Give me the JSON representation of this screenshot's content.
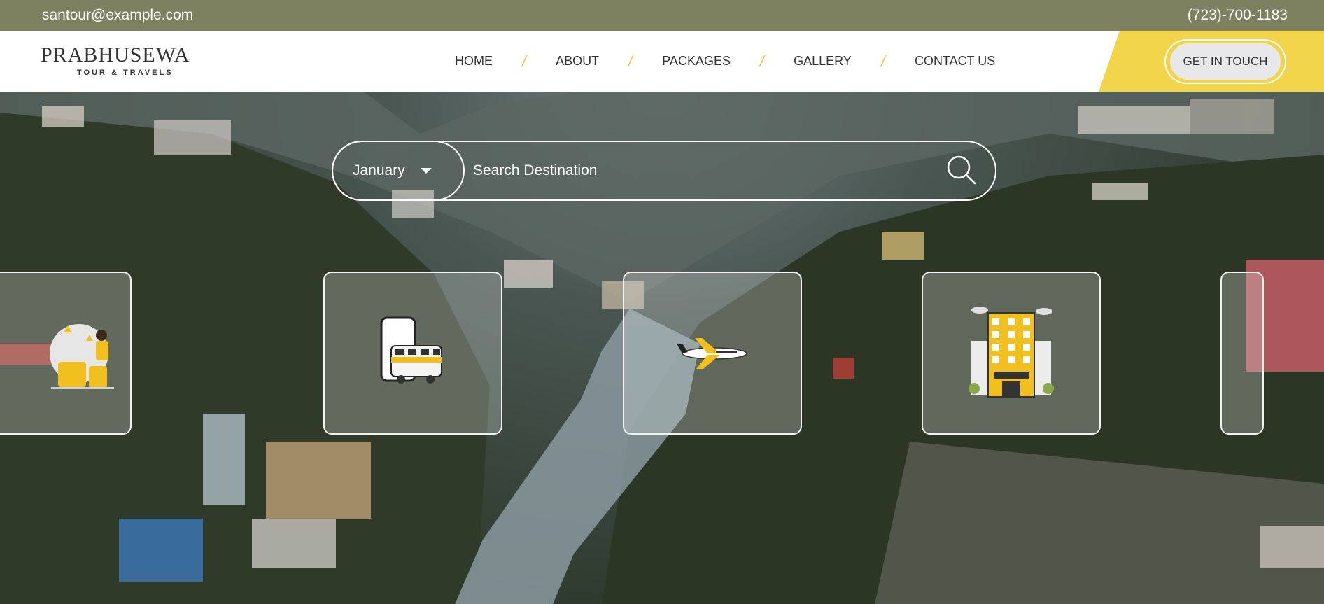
{
  "topbar": {
    "email": "santour@example.com",
    "phone": "(723)-700-1183"
  },
  "header": {
    "logo_name": "PRABHUSEWA",
    "logo_tagline": "TOUR & TRAVELS",
    "nav": [
      "HOME",
      "ABOUT",
      "PACKAGES",
      "GALLERY",
      "CONTACT US"
    ],
    "cta_label": "GET IN TOUCH"
  },
  "search": {
    "month": "January",
    "placeholder": "Search Destination"
  },
  "services": [
    {
      "icon": "traveler-luggage-icon"
    },
    {
      "icon": "train-icon"
    },
    {
      "icon": "airplane-icon"
    },
    {
      "icon": "hotel-icon"
    },
    {
      "icon": "partial-card"
    }
  ],
  "colors": {
    "topbar": "#7d8160",
    "accent": "#f1d44a"
  }
}
